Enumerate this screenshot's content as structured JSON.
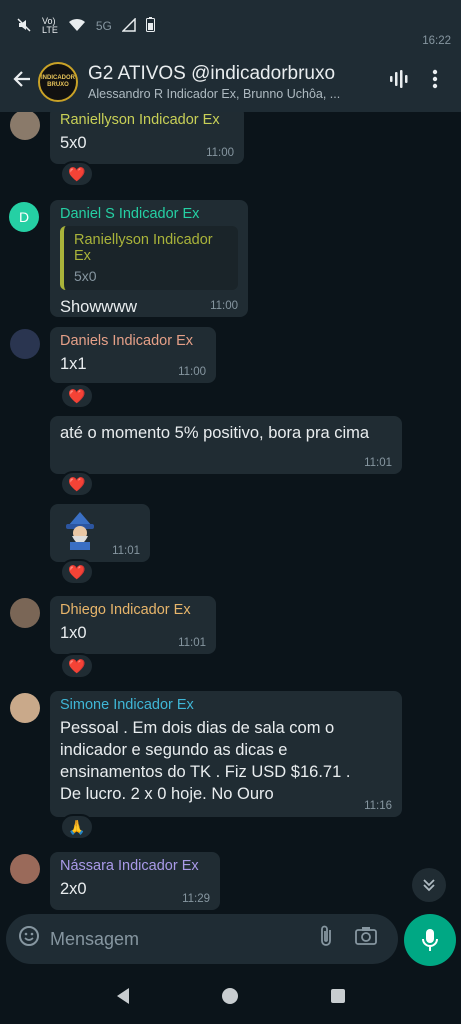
{
  "status": {
    "time": "16:22",
    "indicators": "5G"
  },
  "header": {
    "back_icon": "arrow-left-icon",
    "title": "G2 ATIVOS @indicadorbruxo",
    "subtitle": "Alessandro R Indicador Ex, Brunno Uchôa, ...",
    "avatar_text": "INDICADOR BRUXO"
  },
  "colors": {
    "raniellyson": "#c8d057",
    "daniel_s": "#25d0a4",
    "daniels": "#e5a088",
    "dhiego": "#e7b56b",
    "simone": "#3fb6d6",
    "nassara": "#a99ae8"
  },
  "messages": [
    {
      "sender": "Raniellyson Indicador Ex",
      "text": "5x0",
      "time": "11:00",
      "reaction": "❤️"
    },
    {
      "sender": "Daniel S Indicador Ex",
      "avatar_letter": "D",
      "quote_sender": "Raniellyson Indicador Ex",
      "quote_text": "5x0",
      "text": "Showwww",
      "time": "11:00"
    },
    {
      "sender": "Daniels Indicador Ex",
      "text": "1x1",
      "time": "11:00",
      "reaction": "❤️"
    },
    {
      "text": "até o momento 5% positivo, bora pra cima",
      "time": "11:01",
      "reaction": "❤️"
    },
    {
      "sticker": "wizard-sticker",
      "time": "11:01",
      "reaction": "❤️"
    },
    {
      "sender": "Dhiego Indicador Ex",
      "text": "1x0",
      "time": "11:01",
      "reaction": "❤️"
    },
    {
      "sender": "Simone Indicador Ex",
      "text": "Pessoal . Em dois dias de sala com o indicador e segundo as dicas e ensinamentos do TK . Fiz USD $16.71 . De lucro.  2 x 0 hoje. No Ouro",
      "time": "11:16",
      "reaction": "🙏"
    },
    {
      "sender": "Nássara Indicador Ex",
      "text": "2x0",
      "time": "11:29"
    }
  ],
  "input": {
    "placeholder": "Mensagem"
  }
}
